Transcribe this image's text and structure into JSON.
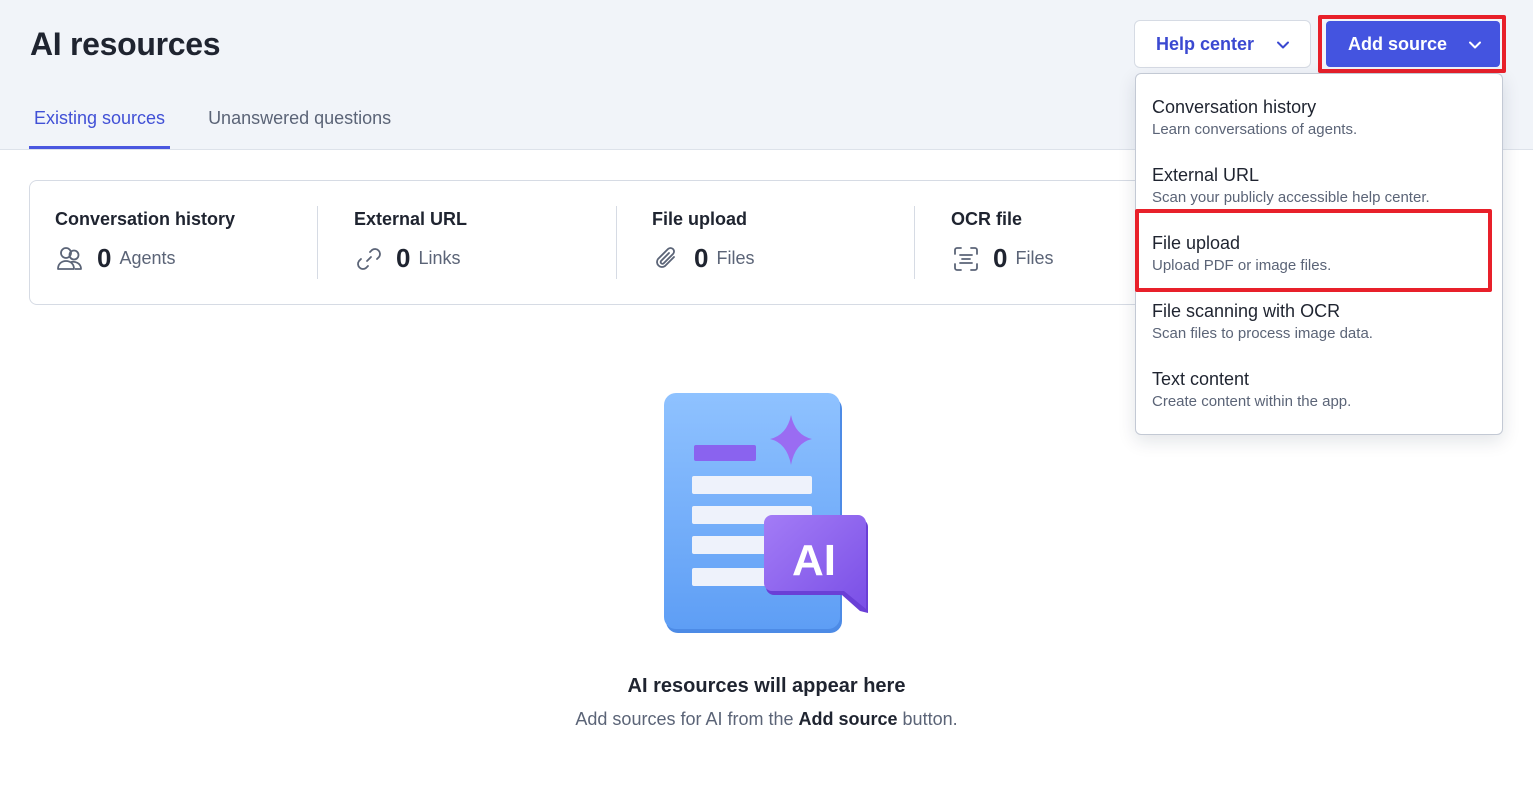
{
  "page": {
    "title": "AI resources"
  },
  "tabs": [
    {
      "label": "Existing sources",
      "active": true
    },
    {
      "label": "Unanswered questions",
      "active": false
    }
  ],
  "header_buttons": {
    "help_center": "Help center",
    "add_source": "Add source"
  },
  "stats": [
    {
      "title": "Conversation history",
      "count": "0",
      "unit": "Agents",
      "icon": "agents-icon"
    },
    {
      "title": "External URL",
      "count": "0",
      "unit": "Links",
      "icon": "link-icon"
    },
    {
      "title": "File upload",
      "count": "0",
      "unit": "Files",
      "icon": "paperclip-icon"
    },
    {
      "title": "OCR file",
      "count": "0",
      "unit": "Files",
      "icon": "ocr-scan-icon"
    }
  ],
  "add_source_menu": [
    {
      "label": "Conversation history",
      "description": "Learn conversations of agents."
    },
    {
      "label": "External URL",
      "description": "Scan your publicly accessible help center."
    },
    {
      "label": "File upload",
      "description": "Upload PDF or image files.",
      "highlighted": true
    },
    {
      "label": "File scanning with OCR",
      "description": "Scan files to process image data."
    },
    {
      "label": "Text content",
      "description": "Create content within the app."
    }
  ],
  "empty_state": {
    "title": "AI resources will appear here",
    "desc_before": "Add sources for AI from the ",
    "desc_bold": "Add source",
    "desc_after": " button.",
    "badge_text": "AI"
  },
  "colors": {
    "accent": "#4454e0",
    "highlight": "#e8202a",
    "header_bg": "#f1f4f9"
  }
}
